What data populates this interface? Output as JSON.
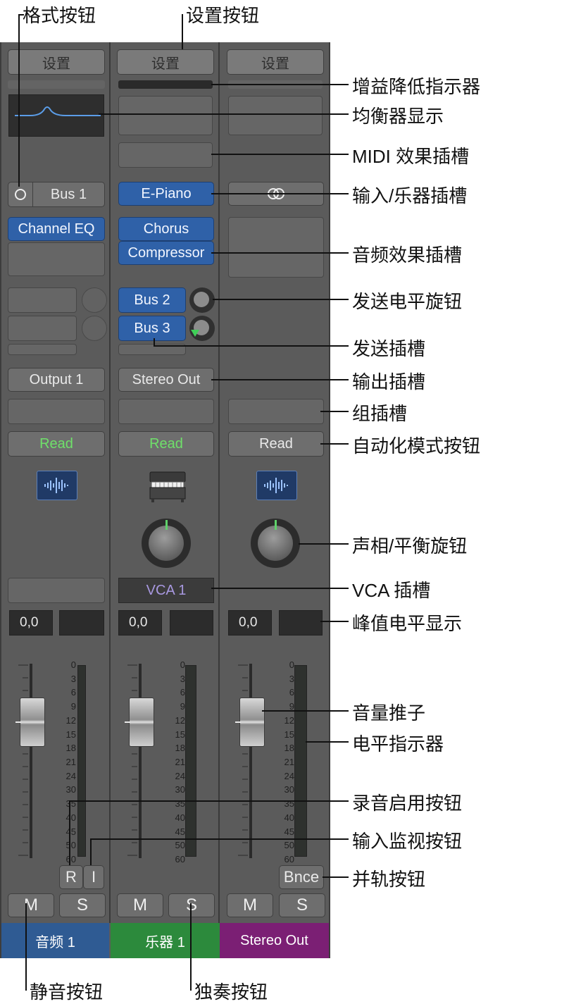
{
  "strips": [
    {
      "setting_label": "设置",
      "input_slot": "Bus 1",
      "audio_fx": [
        "Channel EQ"
      ],
      "output": "Output 1",
      "automation": "Read",
      "peak": "0,0",
      "rec_button": "R",
      "input_monitor_button": "I",
      "mute": "M",
      "solo": "S",
      "name": "音频 1",
      "name_color": "#2f5b93",
      "icon": "waveform-icon"
    },
    {
      "setting_label": "设置",
      "input_slot": "E-Piano",
      "audio_fx": [
        "Chorus",
        "Compressor"
      ],
      "sends": [
        "Bus 2",
        "Bus 3"
      ],
      "output": "Stereo Out",
      "automation": "Read",
      "vca": "VCA 1",
      "peak": "0,0",
      "mute": "M",
      "solo": "S",
      "name": "乐器 1",
      "name_color": "#2c8a3c",
      "icon": "electric-piano-icon"
    },
    {
      "setting_label": "设置",
      "input_slot_icon": "stereo-link-icon",
      "output": "",
      "automation": "Read",
      "peak": "0,0",
      "bounce_button": "Bnce",
      "mute": "M",
      "solo": "S",
      "name": "Stereo Out",
      "name_color": "#7b1f74",
      "icon": "waveform-icon"
    }
  ],
  "meter_scale": [
    "0",
    "3",
    "6",
    "9",
    "12",
    "15",
    "18",
    "21",
    "24",
    "30",
    "35",
    "40",
    "45",
    "50",
    "60"
  ],
  "automation_colors": {
    "read_active": "#6fe06a",
    "read_inactive": "#eeeeee"
  },
  "callouts": {
    "format_button": "格式按钮",
    "settings_button": "设置按钮",
    "gain_reduction": "增益降低指示器",
    "eq_display": "均衡器显示",
    "midi_fx_slot": "MIDI 效果插槽",
    "input_instrument_slot": "输入/乐器插槽",
    "audio_fx_slot": "音频效果插槽",
    "send_level_knob": "发送电平旋钮",
    "send_slot": "发送插槽",
    "output_slot": "输出插槽",
    "group_slot": "组插槽",
    "automation_mode_button": "自动化模式按钮",
    "pan_knob": "声相/平衡旋钮",
    "vca_slot": "VCA 插槽",
    "peak_display": "峰值电平显示",
    "volume_fader": "音量推子",
    "level_meter": "电平指示器",
    "record_enable_button": "录音启用按钮",
    "input_monitor_button": "输入监视按钮",
    "bounce_button": "并轨按钮",
    "mute_button": "静音按钮",
    "solo_button": "独奏按钮"
  }
}
